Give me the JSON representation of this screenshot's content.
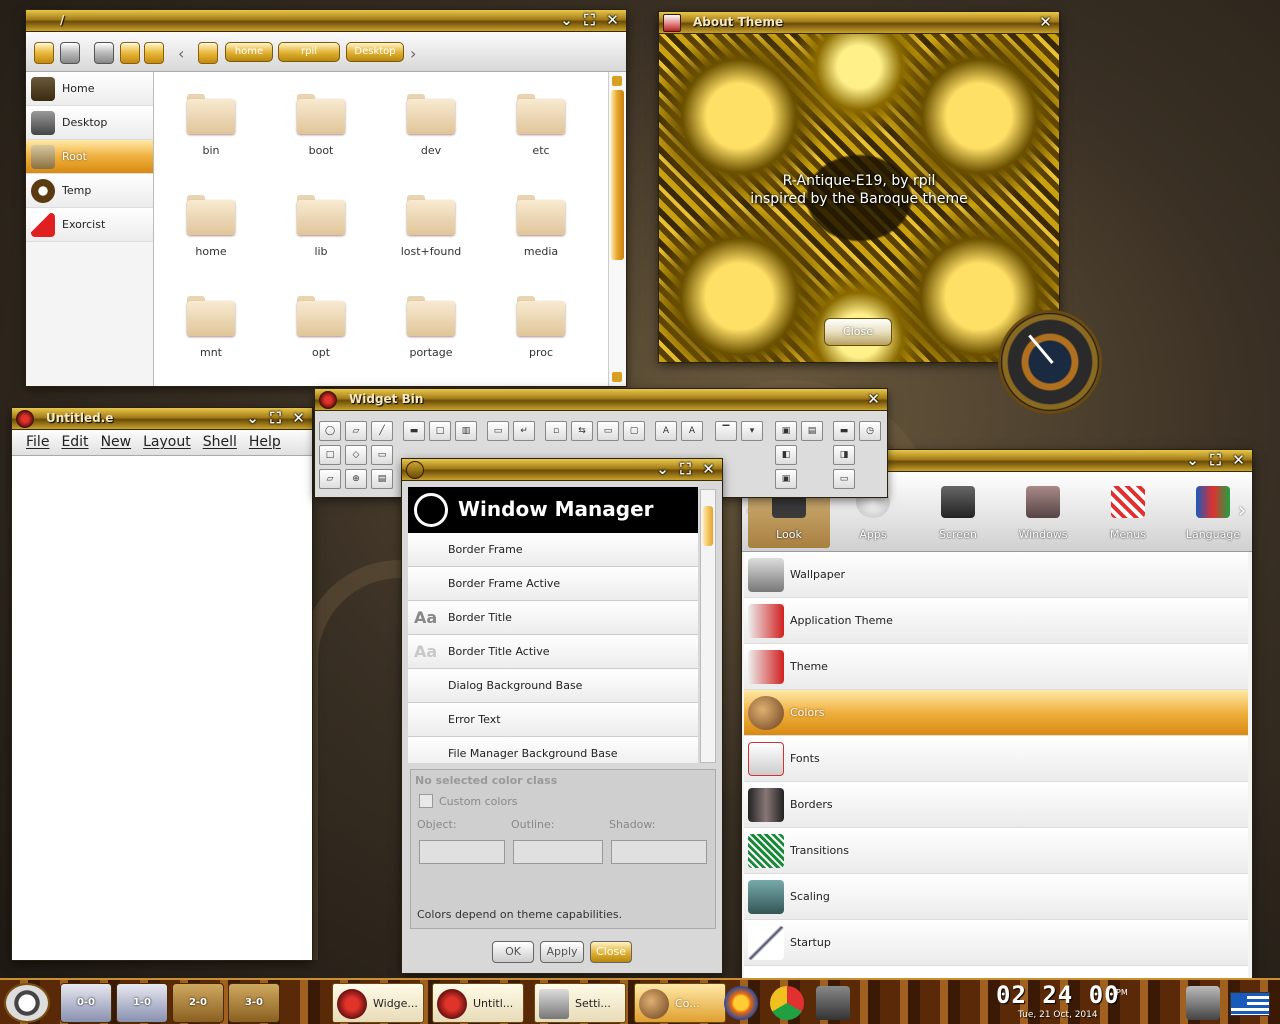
{
  "file_manager": {
    "title": "/",
    "breadcrumbs": [
      "home",
      "rpil",
      "Desktop"
    ],
    "sidebar": [
      {
        "label": "Home",
        "selected": false
      },
      {
        "label": "Desktop",
        "selected": false
      },
      {
        "label": "Root",
        "selected": true
      },
      {
        "label": "Temp",
        "selected": false
      },
      {
        "label": "Exorcist",
        "selected": false
      }
    ],
    "folders": [
      "bin",
      "boot",
      "dev",
      "etc",
      "home",
      "lib",
      "lost+found",
      "media",
      "mnt",
      "opt",
      "portage",
      "proc"
    ]
  },
  "about_theme": {
    "title": "About Theme",
    "line1": "R-Antique-E19, by rpil",
    "line2": "inspired by the Baroque theme",
    "close_label": "Close"
  },
  "untitled": {
    "title": "Untitled.e",
    "menu": [
      "File",
      "Edit",
      "New",
      "Layout",
      "Shell",
      "Help"
    ]
  },
  "widget_bin": {
    "title": "Widget Bin"
  },
  "window_manager": {
    "title": "Window Manager",
    "items": [
      {
        "label": "Border Frame",
        "icon": ""
      },
      {
        "label": "Border Frame Active",
        "icon": ""
      },
      {
        "label": "Border Title",
        "icon": "Aa"
      },
      {
        "label": "Border Title Active",
        "icon": "Aa"
      },
      {
        "label": "Dialog Background Base",
        "icon": ""
      },
      {
        "label": "Error Text",
        "icon": ""
      },
      {
        "label": "File Manager Background Base",
        "icon": ""
      }
    ],
    "panel_header": "No selected color class",
    "custom_colors": "Custom colors",
    "object_label": "Object:",
    "outline_label": "Outline:",
    "shadow_label": "Shadow:",
    "note": "Colors depend on theme capabilities.",
    "ok_label": "OK",
    "apply_label": "Apply",
    "close_label": "Close"
  },
  "settings": {
    "categories": [
      "Look",
      "Apps",
      "Screen",
      "Windows",
      "Menus",
      "Language"
    ],
    "items": [
      {
        "label": "Wallpaper",
        "selected": false
      },
      {
        "label": "Application Theme",
        "selected": false
      },
      {
        "label": "Theme",
        "selected": false
      },
      {
        "label": "Colors",
        "selected": true
      },
      {
        "label": "Fonts",
        "selected": false
      },
      {
        "label": "Borders",
        "selected": false
      },
      {
        "label": "Transitions",
        "selected": false
      },
      {
        "label": "Scaling",
        "selected": false
      },
      {
        "label": "Startup",
        "selected": false
      }
    ]
  },
  "taskbar": {
    "pagers": [
      "0-0",
      "1-0",
      "2-0",
      "3-0"
    ],
    "tasks": [
      "Widge...",
      "Untitl...",
      "Setti...",
      "Co..."
    ],
    "time": "02 24 00",
    "ampm": "PM",
    "date": "Tue, 21 Oct, 2014"
  },
  "colors": {
    "accent": "#e0a030",
    "titlebar": "#a57d1a"
  }
}
